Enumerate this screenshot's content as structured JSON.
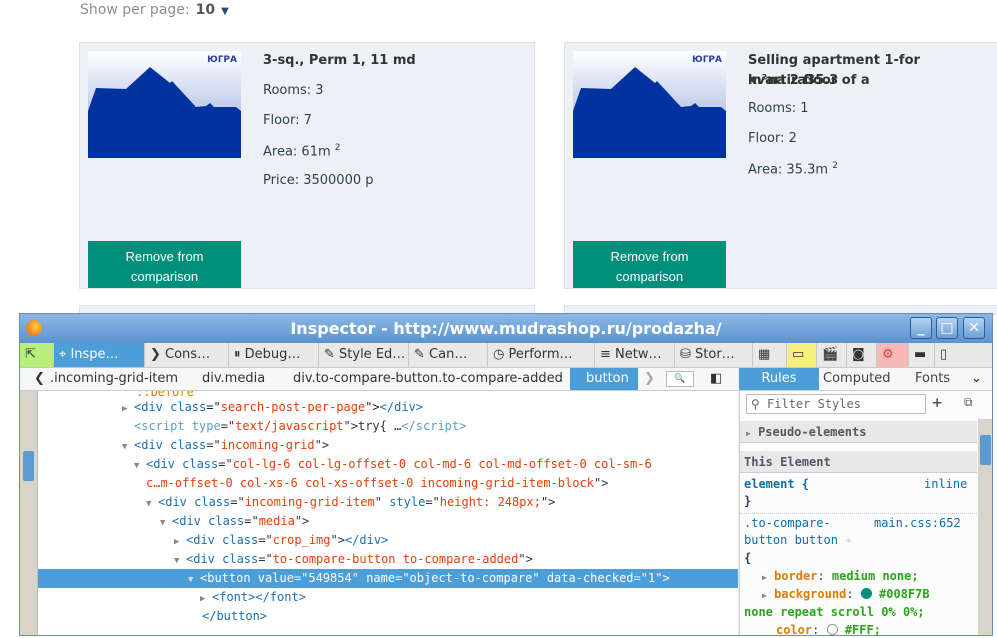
{
  "page": {
    "show_per_page_label": "Show per page:",
    "show_per_page_value": "10",
    "cards": [
      {
        "title": "3-sq., Perm 1, 11 md",
        "rooms": "Rooms: 3",
        "floor": "Floor: 7",
        "area": "Area: 61m",
        "area_sup": "2",
        "price": "Price: 3500000 р",
        "remove_line1": "Remove from",
        "remove_line2": "comparison",
        "logo": "ЮГРА"
      },
      {
        "title_line1": "Selling apartment 1-for kvartira35.3",
        "title_line2": "m²na 2 floor of a",
        "rooms": "Rooms: 1",
        "floor": "Floor: 2",
        "area": "Area: 35.3m",
        "area_sup": "2",
        "remove_line1": "Remove from",
        "remove_line2": "comparison",
        "logo": "ЮГРА"
      }
    ]
  },
  "devtools": {
    "title": "Inspector - http://www.mudrashop.ru/prodazha/",
    "tools": [
      "Inspe…",
      "Cons…",
      "Debug…",
      "Style Ed…",
      "Can…",
      "Perform…",
      "Netw…",
      "Stor…"
    ],
    "breadcrumbs": [
      ".incoming-grid-item",
      "div.media",
      "div.to-compare-button.to-compare-added",
      "button"
    ],
    "side_tabs": [
      "Rules",
      "Computed",
      "Fonts"
    ],
    "filter_placeholder": "Filter Styles",
    "pseudo": "Pseudo-elements",
    "this_element": "This Element",
    "element_rule": "element {",
    "element_close": "}",
    "inline": "inline",
    "selector1": ".to-compare-",
    "selector2": "button button",
    "source": "main.css:652",
    "brace": "{",
    "decl": [
      {
        "prop": "border",
        "val": "medium none;"
      },
      {
        "prop": "background",
        "val": "#008F7B",
        "cont": "none repeat scroll 0% 0%;"
      },
      {
        "prop": "color",
        "val": "#FFF;"
      }
    ],
    "accent": "#008F7B"
  }
}
